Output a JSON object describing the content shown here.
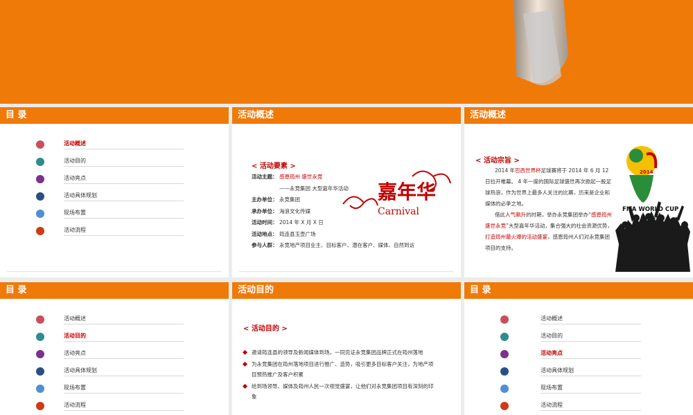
{
  "colors": {
    "accent": "#f07a08",
    "highlight": "#c00000"
  },
  "toc": {
    "title": "目 录",
    "items": [
      {
        "label": "活动概述",
        "color": "#c9505a"
      },
      {
        "label": "活动目的",
        "color": "#2f8c8c"
      },
      {
        "label": "活动亮点",
        "color": "#7a3190"
      },
      {
        "label": "活动具体规划",
        "color": "#2a4f86"
      },
      {
        "label": "现场布置",
        "color": "#4f8fd6"
      },
      {
        "label": "活动流程",
        "color": "#cf3a14"
      }
    ]
  },
  "overview": {
    "title": "活动概述",
    "section": "< 活动要素 >",
    "theme_key": "活动主题：",
    "theme_val": "感恩筠州  盛世永竞",
    "theme_sub": "——永竞集团 大型嘉年华活动",
    "rows": [
      {
        "k": "主办单位：",
        "v": "永竞集团"
      },
      {
        "k": "承办单位：",
        "v": "海浪文化传媒"
      },
      {
        "k": "活动时间：",
        "v": "2014 年 X 月 X 日"
      },
      {
        "k": "活动地点：",
        "v": "筠连县玉壶广场"
      },
      {
        "k": "参与人群：",
        "v": "永竞地产项目业主、目标客户、潜在客户、媒体、自然到访"
      }
    ],
    "logo_cn": "嘉年华",
    "logo_en": "Carnival"
  },
  "purpose_card": {
    "title": "活动概述",
    "section": "< 活动宗旨 >",
    "p1": [
      {
        "t": "2014 年",
        "red": false
      },
      {
        "t": "巴西世界杯",
        "red": true
      },
      {
        "t": "足球赛将于 2014 年 6 月 12 日拉开帷幕。 4 年一度的国际足球盛世再次掀起一股足球热浪，作为世界上最多人关注的比赛，历来是企业和媒体的必争之地。",
        "red": false
      }
    ],
    "p2": [
      {
        "t": "借此",
        "red": false
      },
      {
        "t": "人气飙升",
        "red": true
      },
      {
        "t": "的时期，举办永竞集团举办",
        "red": false
      },
      {
        "t": "“感恩筠州  盛世永竞”",
        "red": true
      },
      {
        "t": "大型嘉年华活动，集合强大的社会资源优势，",
        "red": false
      },
      {
        "t": "打造筠州最火爆的活动盛宴",
        "red": true
      },
      {
        "t": "，感恩筠州人们对永竞集团项目的支持。",
        "red": false
      }
    ],
    "fifa_title": "FIFA WORLD CUP",
    "fifa_sub": "Brasil",
    "fifa_year": "2014"
  },
  "goals": {
    "title": "活动目的",
    "section": "< 活动目的 >",
    "bullets": [
      "邀请筠连县的领导及新闻媒体到场，一同见证永竞集团品牌正式在筠州落地",
      "为永竞集团在筠州落地项目进行推广、造势，吸引更多目标客户关注，为地产项目预热推广及客户积累",
      "给到场领导、媒体及筠州人民一次视觉盛宴，让他们对永竞集团项目有深刻的印象"
    ]
  }
}
